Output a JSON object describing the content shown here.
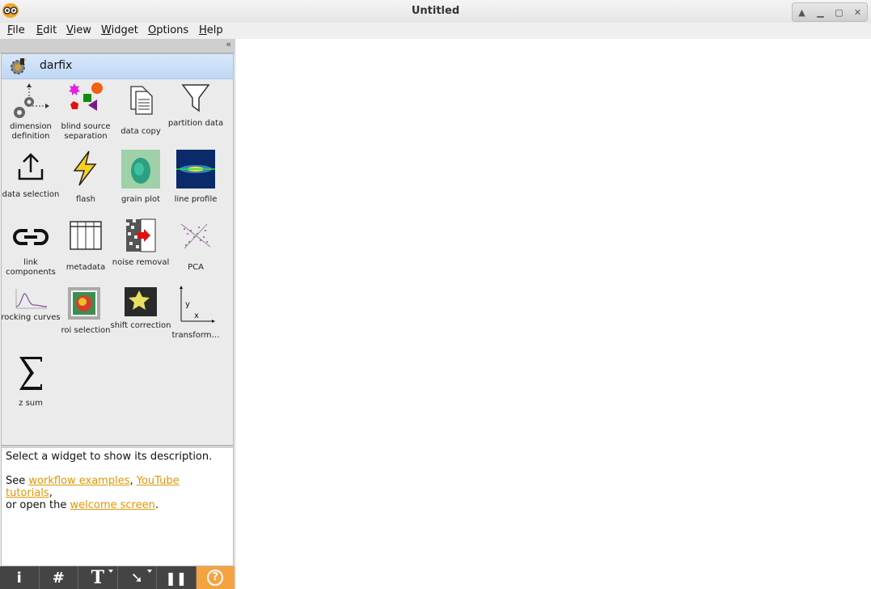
{
  "window": {
    "title": "Untitled",
    "controls": [
      "up-icon",
      "minimize-icon",
      "maximize-icon",
      "close-icon"
    ]
  },
  "menu": [
    "File",
    "Edit",
    "View",
    "Widget",
    "Options",
    "Help"
  ],
  "toolbox": {
    "collapse_glyph": "«",
    "category": "darfix",
    "widgets": [
      {
        "label": "dimension definition",
        "icon": "dimension-definition-icon"
      },
      {
        "label": "blind source separation",
        "icon": "blind-source-separation-icon"
      },
      {
        "label": "data copy",
        "icon": "data-copy-icon"
      },
      {
        "label": "partition data",
        "icon": "partition-data-icon"
      },
      {
        "label": "data selection",
        "icon": "data-selection-icon"
      },
      {
        "label": "flash",
        "icon": "flash-icon"
      },
      {
        "label": "grain plot",
        "icon": "grain-plot-icon"
      },
      {
        "label": "line profile",
        "icon": "line-profile-icon"
      },
      {
        "label": "link components",
        "icon": "link-components-icon"
      },
      {
        "label": "metadata",
        "icon": "metadata-icon"
      },
      {
        "label": "noise removal",
        "icon": "noise-removal-icon"
      },
      {
        "label": "PCA",
        "icon": "pca-icon"
      },
      {
        "label": "rocking curves",
        "icon": "rocking-curves-icon"
      },
      {
        "label": "roi selection",
        "icon": "roi-selection-icon"
      },
      {
        "label": "shift correction",
        "icon": "shift-correction-icon"
      },
      {
        "label": "transform…",
        "icon": "transformation-icon"
      },
      {
        "label": "z sum",
        "icon": "z-sum-icon"
      }
    ]
  },
  "description": {
    "line1": "Select a widget to show its description.",
    "see": "See ",
    "link1": "workflow examples",
    "comma": ", ",
    "link2": "YouTube tutorials",
    "or_open": ",\nor open the ",
    "link3": "welcome screen",
    "period": "."
  },
  "bottom_bar": [
    {
      "glyph": "i",
      "icon": "info-icon"
    },
    {
      "glyph": "#",
      "icon": "grid-icon"
    },
    {
      "glyph": "T",
      "icon": "text-annotation-icon"
    },
    {
      "glyph": "➘",
      "icon": "arrow-annotation-icon"
    },
    {
      "glyph": "❚❚",
      "icon": "pause-icon"
    },
    {
      "glyph": "?",
      "icon": "help-icon"
    }
  ]
}
